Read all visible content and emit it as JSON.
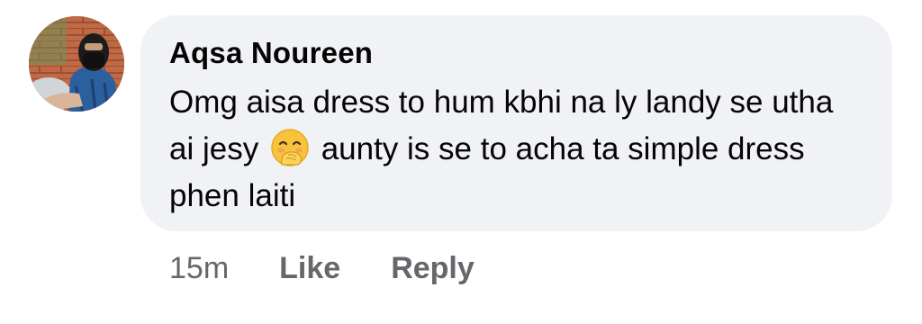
{
  "comment": {
    "author": "Aqsa Noureen",
    "text_before_emoji": "Omg aisa dress to hum kbhi na ly landy se utha ai jesy",
    "emoji": "face-with-hand-over-mouth-emoji",
    "text_after_emoji": "aunty is se to acha ta simple dress phen laiti",
    "timestamp": "15m",
    "like_label": "Like",
    "reply_label": "Reply"
  },
  "colors": {
    "bubble_background": "#f0f2f5",
    "text_primary": "#050505",
    "text_secondary": "#65676b"
  }
}
